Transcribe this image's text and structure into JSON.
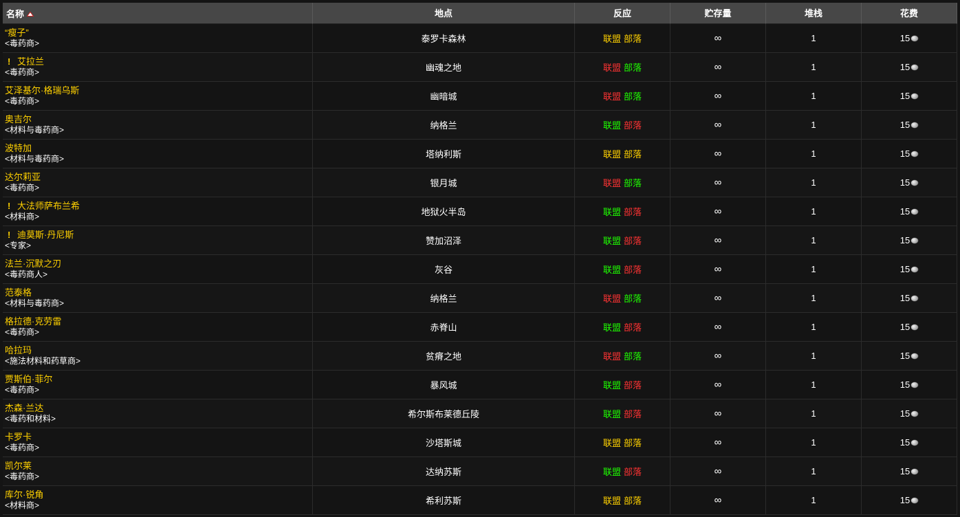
{
  "columns": {
    "name": "名称",
    "location": "地点",
    "reaction": "反应",
    "stock": "贮存量",
    "stack": "堆栈",
    "cost": "花费"
  },
  "colors": {
    "friendly": "#1eff00",
    "hostile": "#ff3333",
    "neutral": "#ffd100"
  },
  "rows": [
    {
      "name": "“瘦子”",
      "title": "<毒药商>",
      "quest": false,
      "location": "泰罗卡森林",
      "alliance": "联盟",
      "horde": "部落",
      "alliance_color": "#ffd100",
      "horde_color": "#ffd100",
      "stock": "∞",
      "stack": "1",
      "cost": "15",
      "coin_icon": "silver-coin-icon"
    },
    {
      "name": "艾拉兰",
      "title": "<毒药商>",
      "quest": true,
      "location": "幽魂之地",
      "alliance": "联盟",
      "horde": "部落",
      "alliance_color": "#ff3333",
      "horde_color": "#1eff00",
      "stock": "∞",
      "stack": "1",
      "cost": "15",
      "coin_icon": "silver-coin-icon"
    },
    {
      "name": "艾泽基尔·格瑞乌斯",
      "title": "<毒药商>",
      "quest": false,
      "location": "幽暗城",
      "alliance": "联盟",
      "horde": "部落",
      "alliance_color": "#ff3333",
      "horde_color": "#1eff00",
      "stock": "∞",
      "stack": "1",
      "cost": "15",
      "coin_icon": "silver-coin-icon"
    },
    {
      "name": "奥吉尔",
      "title": "<材料与毒药商>",
      "quest": false,
      "location": "纳格兰",
      "alliance": "联盟",
      "horde": "部落",
      "alliance_color": "#1eff00",
      "horde_color": "#ff3333",
      "stock": "∞",
      "stack": "1",
      "cost": "15",
      "coin_icon": "silver-coin-icon"
    },
    {
      "name": "波特加",
      "title": "<材料与毒药商>",
      "quest": false,
      "location": "塔纳利斯",
      "alliance": "联盟",
      "horde": "部落",
      "alliance_color": "#ffd100",
      "horde_color": "#ffd100",
      "stock": "∞",
      "stack": "1",
      "cost": "15",
      "coin_icon": "silver-coin-icon"
    },
    {
      "name": "达尔莉亚",
      "title": "<毒药商>",
      "quest": false,
      "location": "银月城",
      "alliance": "联盟",
      "horde": "部落",
      "alliance_color": "#ff3333",
      "horde_color": "#1eff00",
      "stock": "∞",
      "stack": "1",
      "cost": "15",
      "coin_icon": "silver-coin-icon"
    },
    {
      "name": "大法师萨布兰希",
      "title": "<材料商>",
      "quest": true,
      "location": "地狱火半岛",
      "alliance": "联盟",
      "horde": "部落",
      "alliance_color": "#1eff00",
      "horde_color": "#ff3333",
      "stock": "∞",
      "stack": "1",
      "cost": "15",
      "coin_icon": "silver-coin-icon"
    },
    {
      "name": "迪莫斯·丹尼斯",
      "title": "<专家>",
      "quest": true,
      "location": "赞加沼泽",
      "alliance": "联盟",
      "horde": "部落",
      "alliance_color": "#1eff00",
      "horde_color": "#ff3333",
      "stock": "∞",
      "stack": "1",
      "cost": "15",
      "coin_icon": "silver-coin-icon"
    },
    {
      "name": "法兰·沉默之刃",
      "title": "<毒药商人>",
      "quest": false,
      "location": "灰谷",
      "alliance": "联盟",
      "horde": "部落",
      "alliance_color": "#1eff00",
      "horde_color": "#ff3333",
      "stock": "∞",
      "stack": "1",
      "cost": "15",
      "coin_icon": "silver-coin-icon"
    },
    {
      "name": "范泰格",
      "title": "<材料与毒药商>",
      "quest": false,
      "location": "纳格兰",
      "alliance": "联盟",
      "horde": "部落",
      "alliance_color": "#ff3333",
      "horde_color": "#1eff00",
      "stock": "∞",
      "stack": "1",
      "cost": "15",
      "coin_icon": "silver-coin-icon"
    },
    {
      "name": "格拉德·克劳雷",
      "title": "<毒药商>",
      "quest": false,
      "location": "赤脊山",
      "alliance": "联盟",
      "horde": "部落",
      "alliance_color": "#1eff00",
      "horde_color": "#ff3333",
      "stock": "∞",
      "stack": "1",
      "cost": "15",
      "coin_icon": "silver-coin-icon"
    },
    {
      "name": "哈拉玛",
      "title": "<施法材料和药草商>",
      "quest": false,
      "location": "贫瘠之地",
      "alliance": "联盟",
      "horde": "部落",
      "alliance_color": "#ff3333",
      "horde_color": "#1eff00",
      "stock": "∞",
      "stack": "1",
      "cost": "15",
      "coin_icon": "silver-coin-icon"
    },
    {
      "name": "贾斯伯·菲尔",
      "title": "<毒药商>",
      "quest": false,
      "location": "暴风城",
      "alliance": "联盟",
      "horde": "部落",
      "alliance_color": "#1eff00",
      "horde_color": "#ff3333",
      "stock": "∞",
      "stack": "1",
      "cost": "15",
      "coin_icon": "silver-coin-icon"
    },
    {
      "name": "杰森·兰达",
      "title": "<毒药和材料>",
      "quest": false,
      "location": "希尔斯布莱德丘陵",
      "alliance": "联盟",
      "horde": "部落",
      "alliance_color": "#1eff00",
      "horde_color": "#ff3333",
      "stock": "∞",
      "stack": "1",
      "cost": "15",
      "coin_icon": "silver-coin-icon"
    },
    {
      "name": "卡罗卡",
      "title": "<毒药商>",
      "quest": false,
      "location": "沙塔斯城",
      "alliance": "联盟",
      "horde": "部落",
      "alliance_color": "#ffd100",
      "horde_color": "#ffd100",
      "stock": "∞",
      "stack": "1",
      "cost": "15",
      "coin_icon": "silver-coin-icon"
    },
    {
      "name": "凯尔莱",
      "title": "<毒药商>",
      "quest": false,
      "location": "达纳苏斯",
      "alliance": "联盟",
      "horde": "部落",
      "alliance_color": "#1eff00",
      "horde_color": "#ff3333",
      "stock": "∞",
      "stack": "1",
      "cost": "15",
      "coin_icon": "silver-coin-icon"
    },
    {
      "name": "库尔·锐角",
      "title": "<材料商>",
      "quest": false,
      "location": "希利苏斯",
      "alliance": "联盟",
      "horde": "部落",
      "alliance_color": "#ffd100",
      "horde_color": "#ffd100",
      "stock": "∞",
      "stack": "1",
      "cost": "15",
      "coin_icon": "silver-coin-icon"
    }
  ]
}
